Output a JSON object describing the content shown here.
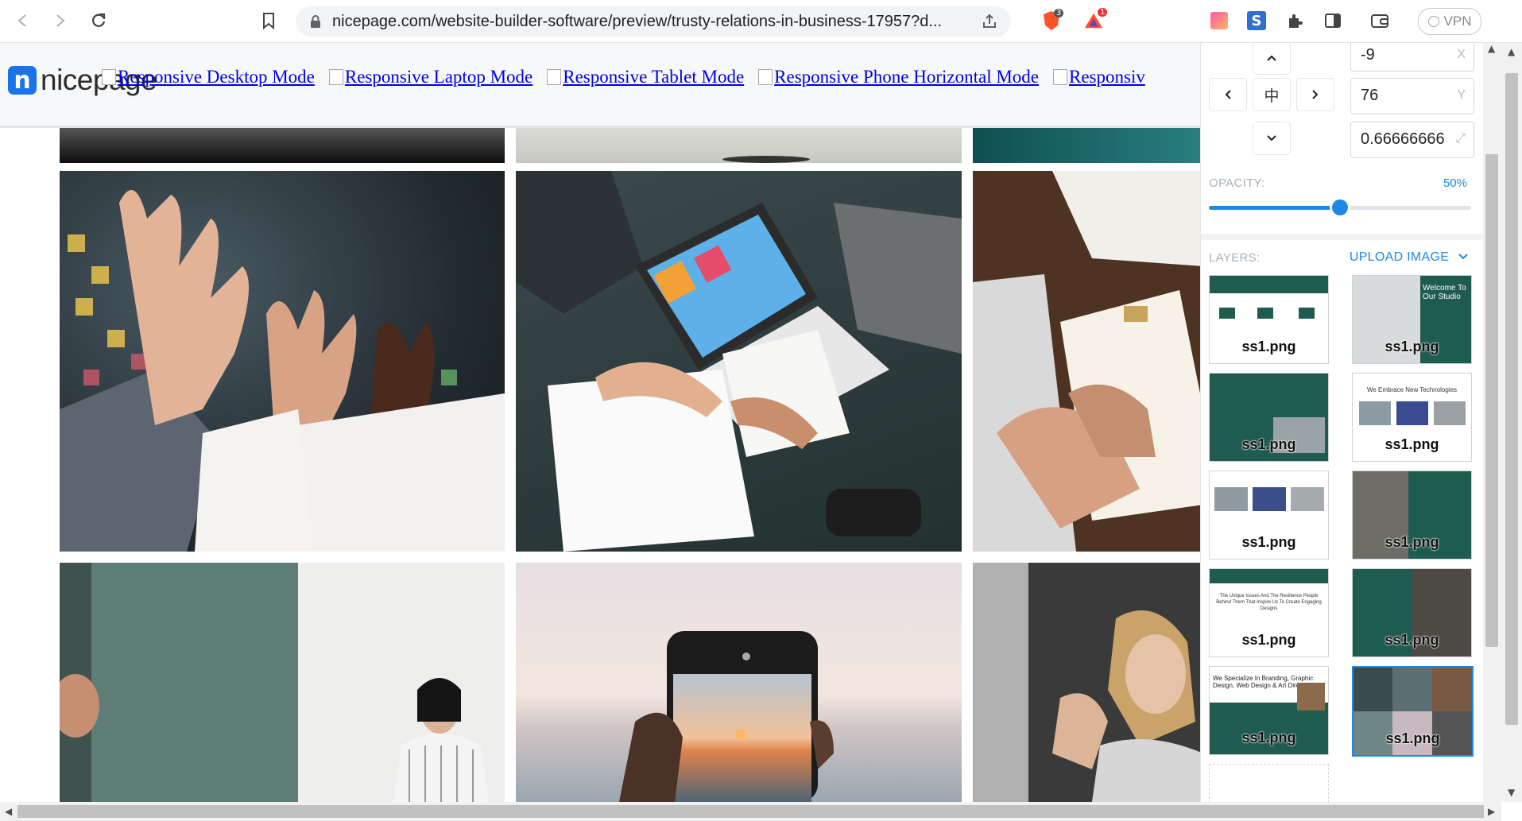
{
  "browser": {
    "url": "nicepage.com/website-builder-software/preview/trusty-relations-in-business-17957?d...",
    "brave_badge": "3",
    "alert_badge": "1",
    "vpn_label": "VPN"
  },
  "site": {
    "logo_text": "nicepage",
    "logo_letter": "n",
    "mode_links": [
      "Responsive Desktop Mode",
      "Responsive Laptop Mode",
      "Responsive Tablet Mode",
      "Responsive Phone Horizontal Mode",
      "Responsiv"
    ]
  },
  "panel": {
    "x_value": "-9",
    "x_suffix": "X",
    "y_value": "76",
    "y_suffix": "Y",
    "scale_value": "0.66666666",
    "center_glyph": "中",
    "opacity_label": "OPACITY:",
    "opacity_value": "50%",
    "opacity_fraction": 0.5,
    "layers_label": "LAYERS:",
    "upload_label": "UPLOAD IMAGE",
    "layers": [
      "ss1.png",
      "ss1.png",
      "ss1.png",
      "ss1.png",
      "ss1.png",
      "ss1.png",
      "ss1.png",
      "ss1.png",
      "ss1.png",
      "ss1.png"
    ],
    "layer_texts": {
      "welcome": "Welcome To Our Studio",
      "embrace": "We Embrace New Technologies",
      "unique": "The Unique Issues And The Resilience People Behind Them That Inspire Us To Create Engaging Designs",
      "specialize": "We Specialize In Branding, Graphic Design, Web Design & Art Direction"
    }
  },
  "colors": {
    "accent": "#1e88e5",
    "link": "#0000ee",
    "teal": "#1f5b4f"
  }
}
